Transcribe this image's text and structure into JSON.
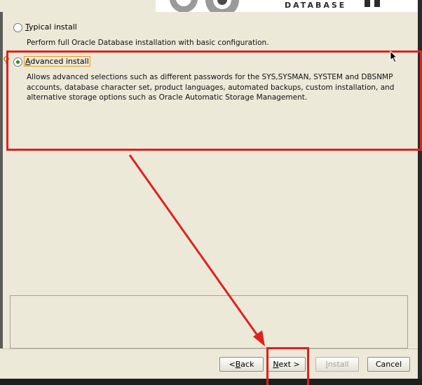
{
  "header": {
    "brand_word": "DATABASE"
  },
  "options": [
    {
      "label": "Typical install",
      "mnemonic": "T",
      "description": "Perform full Oracle Database installation with basic configuration.",
      "selected": false
    },
    {
      "label": "Advanced install",
      "mnemonic": "A",
      "description": "Allows advanced selections such as different passwords for the SYS,SYSMAN, SYSTEM and DBSNMP accounts, database character set, product languages, automated backups, custom installation, and alternative storage options such as Oracle Automatic Storage Management.",
      "selected": true
    }
  ],
  "buttons": {
    "back": "< Back",
    "next": "Next >",
    "install": "Install",
    "cancel": "Cancel"
  },
  "colors": {
    "annotation": "#e02020",
    "window_bg": "#ece9d8",
    "focus": "#e2a020"
  }
}
